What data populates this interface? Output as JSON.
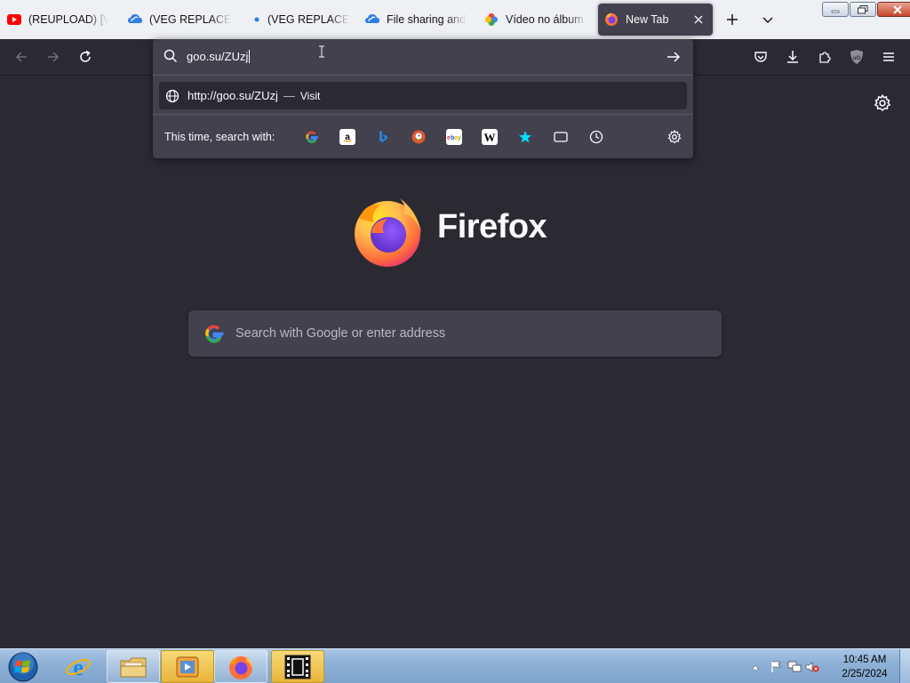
{
  "tabs": [
    {
      "title": "(REUPLOAD) [VE",
      "icon": "youtube-icon"
    },
    {
      "title": "(VEG REPLACE)[R",
      "icon": "gdrive-cloud-icon"
    },
    {
      "title": "(VEG REPLACE)[K",
      "icon": "tab-dot-icon"
    },
    {
      "title": "File sharing and s",
      "icon": "gdrive-cloud-icon"
    },
    {
      "title": "Vídeo no álbum E",
      "icon": "google-photos-icon"
    },
    {
      "title": "New Tab",
      "icon": "firefox-icon",
      "active": true
    }
  ],
  "urlbar": {
    "value": "goo.su/ZUzj",
    "suggestion": {
      "url": "http://goo.su/ZUzj",
      "separator": "—",
      "action": "Visit"
    },
    "oneoff_label": "This time, search with:",
    "engines": [
      "Google",
      "Amazon",
      "Bing",
      "DuckDuckGo",
      "eBay",
      "Wikipedia",
      "Bookmarks",
      "Tabs",
      "History"
    ]
  },
  "newtab": {
    "brand": "Firefox",
    "search_placeholder": "Search with Google or enter address"
  },
  "taskbar": {
    "apps": [
      "start",
      "internet-explorer",
      "file-explorer",
      "media-player",
      "firefox",
      "video-editor"
    ],
    "clock": {
      "time": "10:45 AM",
      "date": "2/25/2024"
    }
  },
  "colors": {
    "toolbar_bg": "#2b2a33",
    "panel_bg": "#42414d",
    "tabstrip_bg": "#eef0f4",
    "text": "#fbfbfe",
    "firefox_orange": "#ff7139",
    "firefox_purple": "#7542e5"
  }
}
